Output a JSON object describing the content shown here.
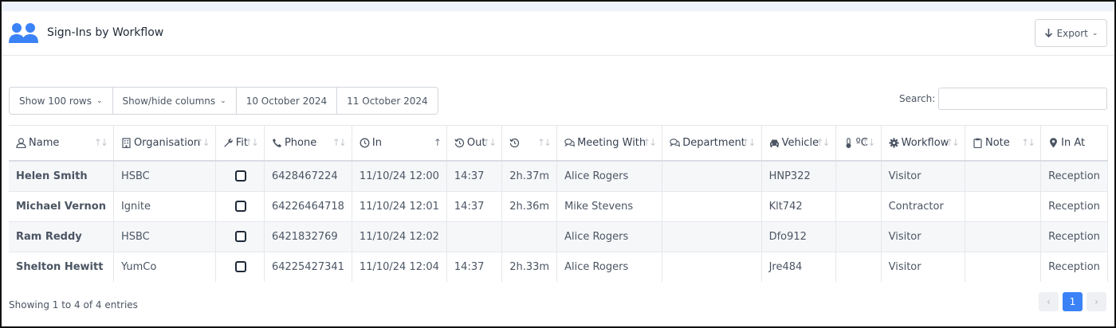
{
  "header": {
    "title": "Sign-Ins by Workflow",
    "export_label": "Export"
  },
  "toolbar": {
    "show_rows_label": "Show 100 rows",
    "show_hide_label": "Show/hide columns",
    "date_from": "10 October 2024",
    "date_to": "11 October 2024",
    "search_label": "Search:",
    "search_value": ""
  },
  "table": {
    "columns": [
      {
        "label": "Name",
        "icon": "user-icon"
      },
      {
        "label": "Organisation",
        "icon": "building-icon"
      },
      {
        "label": "Fit",
        "icon": "wrench-icon"
      },
      {
        "label": "Phone",
        "icon": "phone-icon"
      },
      {
        "label": "In",
        "icon": "clock-icon"
      },
      {
        "label": "Out",
        "icon": "history-icon"
      },
      {
        "label": "",
        "icon": "history-icon"
      },
      {
        "label": "Meeting With",
        "icon": "comments-icon"
      },
      {
        "label": "Department",
        "icon": "comments-icon"
      },
      {
        "label": "Vehicle",
        "icon": "car-icon"
      },
      {
        "label": "ºC",
        "icon": "thermometer-icon"
      },
      {
        "label": "Workflow",
        "icon": "gear-icon"
      },
      {
        "label": "Note",
        "icon": "clipboard-icon"
      },
      {
        "label": "In At",
        "icon": "map-pin-icon"
      }
    ],
    "rows": [
      {
        "name": "Helen Smith",
        "organisation": "HSBC",
        "fit": false,
        "phone": "6428467224",
        "in": "11/10/24 12:00",
        "out": "14:37",
        "duration": "2h.37m",
        "meeting_with": "Alice Rogers",
        "department": "",
        "vehicle": "HNP322",
        "temp": "",
        "workflow": "Visitor",
        "note": "",
        "in_at": "Reception"
      },
      {
        "name": "Michael Vernon",
        "organisation": "Ignite",
        "fit": false,
        "phone": "64226464718",
        "in": "11/10/24 12:01",
        "out": "14:37",
        "duration": "2h.36m",
        "meeting_with": "Mike Stevens",
        "department": "",
        "vehicle": "Klt742",
        "temp": "",
        "workflow": "Contractor",
        "note": "",
        "in_at": "Reception"
      },
      {
        "name": "Ram Reddy",
        "organisation": "HSBC",
        "fit": false,
        "phone": "6421832769",
        "in": "11/10/24 12:02",
        "out": "",
        "duration": "",
        "meeting_with": "Alice Rogers",
        "department": "",
        "vehicle": "Dfo912",
        "temp": "",
        "workflow": "Visitor",
        "note": "",
        "in_at": "Reception"
      },
      {
        "name": "Shelton Hewitt",
        "organisation": "YumCo",
        "fit": false,
        "phone": "64225427341",
        "in": "11/10/24 12:04",
        "out": "14:37",
        "duration": "2h.33m",
        "meeting_with": "Alice Rogers",
        "department": "",
        "vehicle": "Jre484",
        "temp": "",
        "workflow": "Visitor",
        "note": "",
        "in_at": "Reception"
      }
    ]
  },
  "footer": {
    "info": "Showing 1 to 4 of 4 entries",
    "prev": "‹",
    "page": "1",
    "next": "›"
  },
  "colors": {
    "accent": "#3b82f6",
    "icon_blue": "#3b82f6"
  }
}
